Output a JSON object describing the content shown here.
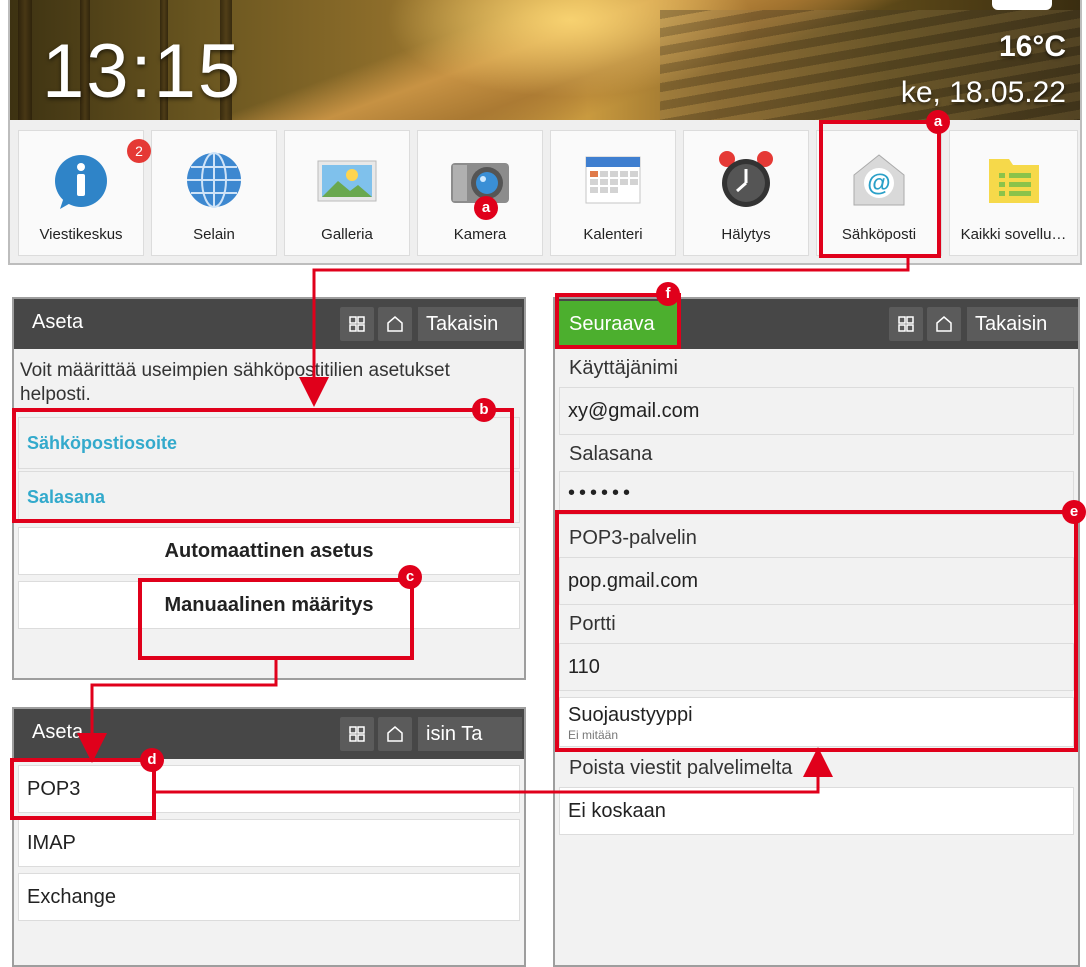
{
  "home": {
    "time": "13:15",
    "temperature": "16°C",
    "date": "ke, 18.05.22",
    "apps": [
      {
        "label": "Viestikeskus",
        "icon": "info-message-icon",
        "badge": "2"
      },
      {
        "label": "Selain",
        "icon": "globe-icon"
      },
      {
        "label": "Galleria",
        "icon": "gallery-icon"
      },
      {
        "label": "Kamera",
        "icon": "camera-icon"
      },
      {
        "label": "Kalenteri",
        "icon": "calendar-icon"
      },
      {
        "label": "Hälytys",
        "icon": "alarm-clock-icon"
      },
      {
        "label": "Sähköposti",
        "icon": "email-at-icon"
      },
      {
        "label": "Kaikki sovellu…",
        "icon": "all-apps-list-icon"
      }
    ]
  },
  "setup_panel": {
    "title": "Aseta",
    "back_label": "Takaisin",
    "description": "Voit määrittää useimpien sähköpostitilien asetukset helposti.",
    "email_placeholder": "Sähköpostiosoite",
    "password_placeholder": "Salasana",
    "auto_setup": "Automaattinen asetus",
    "manual_setup": "Manuaalinen määritys"
  },
  "account_type_panel": {
    "title": "Aseta",
    "back_label": "isin   Ta",
    "options": [
      "POP3",
      "IMAP",
      "Exchange"
    ]
  },
  "server_panel": {
    "next_label": "Seuraava",
    "back_label": "Takaisin",
    "username_label": "Käyttäjänimi",
    "username_value": "xy@gmail.com",
    "password_label": "Salasana",
    "password_value": "••••••",
    "pop3_label": "POP3-palvelin",
    "pop3_value": "pop.gmail.com",
    "port_label": "Portti",
    "port_value": "110",
    "security_label": "Suojaustyyppi",
    "security_value": "Ei mitään",
    "delete_label": "Poista viestit palvelimelta",
    "delete_value": "Ei koskaan"
  },
  "annotations": {
    "markers": [
      "a",
      "a",
      "b",
      "c",
      "d",
      "e",
      "f"
    ],
    "color": "#e0001b"
  }
}
